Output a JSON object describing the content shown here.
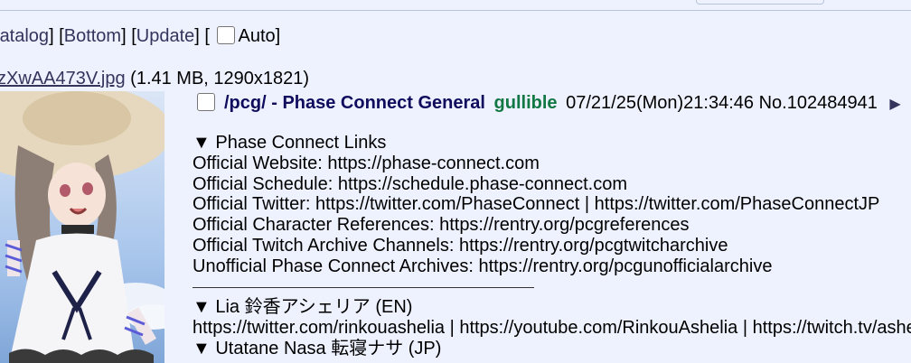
{
  "nav": {
    "catalog_label": "atalog",
    "bottom_label": "Bottom",
    "update_label": "Update",
    "auto_label": "Auto"
  },
  "file": {
    "name": "zXwAA473V.jpg",
    "meta": "(1.41 MB, 1290x1821)"
  },
  "post": {
    "subject": "/pcg/ - Phase Connect General",
    "name": "gullible",
    "datetime": "07/21/25(Mon)21:34:46",
    "number": "No.102484941",
    "menu_icon": "triangle-right-icon",
    "lines": [
      "▼ Phase Connect Links",
      "Official Website: https://phase-connect.com",
      "Official Schedule: https://schedule.phase-connect.com",
      "Official Twitter: https://twitter.com/PhaseConnect | https://twitter.com/PhaseConnectJP",
      "Official Character References: https://rentry.org/pcgreferences",
      "Official Twitch Archive Channels: https://rentry.org/pcgtwitcharchive",
      "Unofficial Phase Connect Archives: https://rentry.org/pcgunofficialarchive"
    ],
    "lines2": [
      "▼ Lia 鈴香アシェリア (EN)",
      "https://twitter.com/rinkouashelia | https://youtube.com/RinkouAshelia | https://twitch.tv/ashe",
      "▼ Utatane Nasa 転寝ナサ (JP)"
    ]
  },
  "colors": {
    "background": "#eef2ff",
    "link": "#34345c",
    "subject": "#0f0c5d",
    "name": "#117743"
  }
}
